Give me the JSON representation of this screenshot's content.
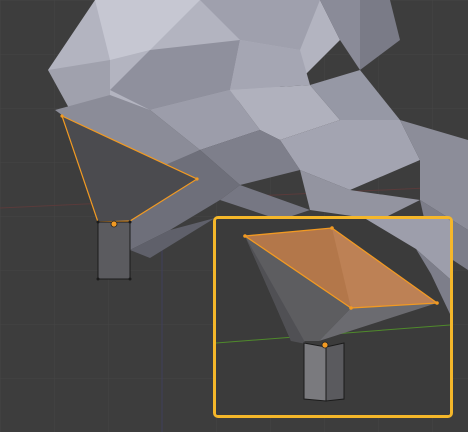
{
  "viewport": {
    "background_color": "#3d3d3d",
    "grid_color": "#454545",
    "mesh_color": "#a8a9b6",
    "selection_color": "#f29a22"
  },
  "inset": {
    "border_color": "#f5b72a",
    "selected_face_color": "#c9834e",
    "x_axis_color": "#8a2f2f",
    "y_axis_color": "#4f8a2b"
  }
}
